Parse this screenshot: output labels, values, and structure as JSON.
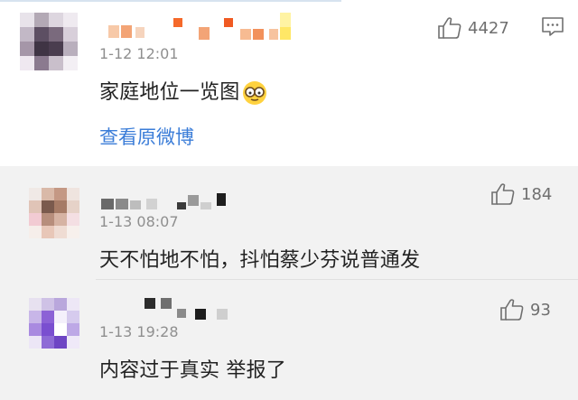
{
  "main_comment": {
    "time": "1-12 12:01",
    "text": "家庭地位一览图",
    "emoji": "glasses-face-emoji",
    "likes": "4427",
    "view_original": "查看原微博"
  },
  "replies": [
    {
      "time": "1-13 08:07",
      "text": "天不怕地不怕，抖怕蔡少芬说普通发",
      "likes": "184"
    },
    {
      "time": "1-13 19:28",
      "text": "内容过于真实  举报了",
      "likes": "93"
    }
  ],
  "icons": {
    "like": "thumbs-up-icon",
    "comment": "comment-icon"
  },
  "colors": {
    "link": "#3b7dd8",
    "reply_bg": "#f2f2f2",
    "meta_text": "#8f8f8f"
  }
}
